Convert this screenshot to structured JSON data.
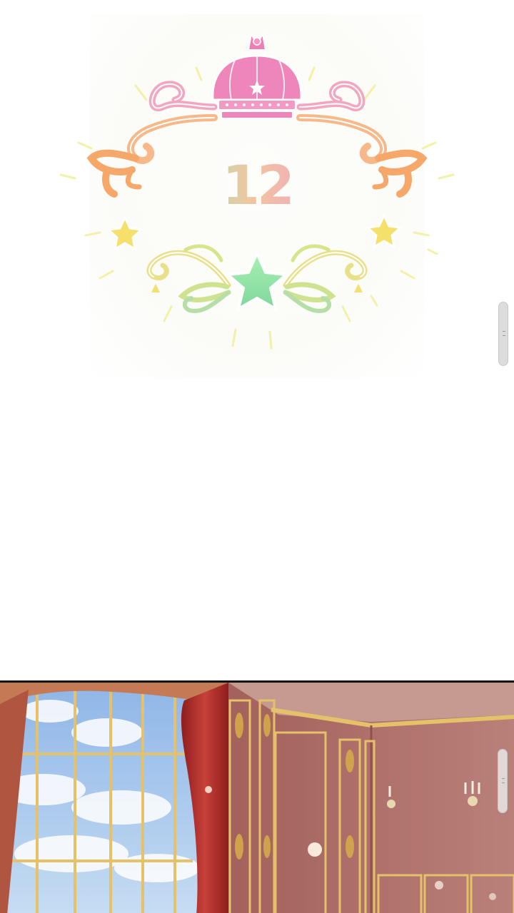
{
  "chapter": {
    "number": "12"
  },
  "colors": {
    "crown": "#ee86bb",
    "swirl_pink": "#f3a6c0",
    "swirl_orange": "#f5a86a",
    "star_yellow": "#f4e06a",
    "star_green": "#8fe3a8",
    "vine_green": "#cfe28f",
    "wall": "#a96a63",
    "gold_trim": "#d9b25a",
    "curtain": "#b8322e",
    "sky": "#a9c8ec"
  },
  "icons": {
    "crown": "crown-icon",
    "stars": "star-icon",
    "scroll": "scroll-handle"
  }
}
